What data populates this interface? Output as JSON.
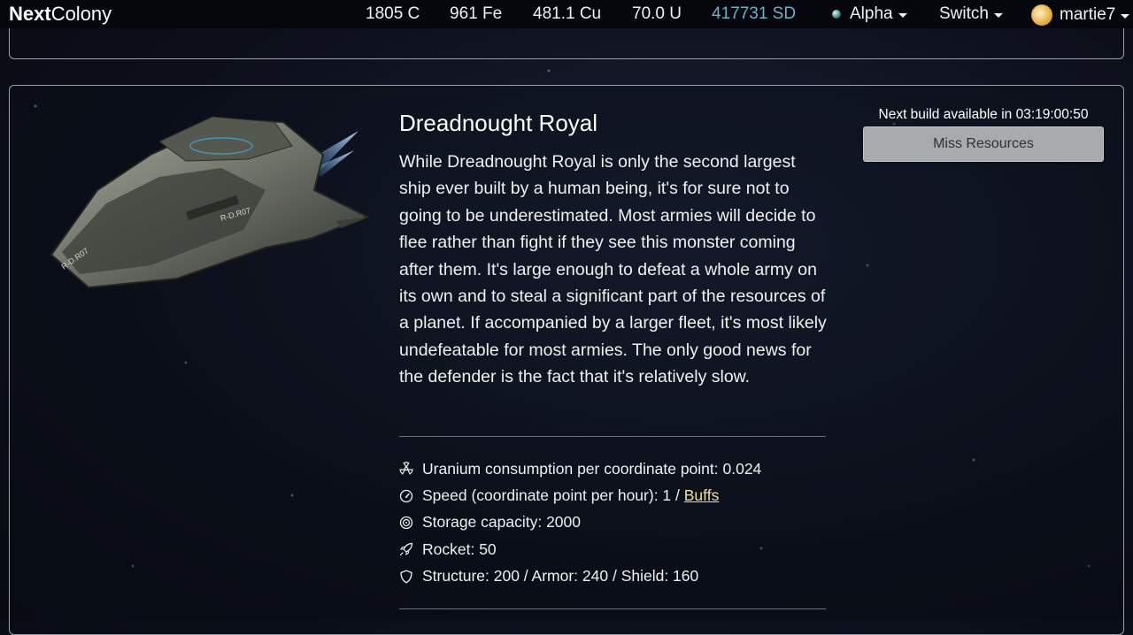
{
  "navbar": {
    "brand_bold": "Next",
    "brand_rest": "Colony",
    "resources": {
      "coal": "1805 C",
      "ore": "961 Fe",
      "copper": "481.1 Cu",
      "uranium": "70.0 U",
      "sd": "417731 SD"
    },
    "planet_label": "Alpha",
    "switch_label": "Switch",
    "user_label": "martie7"
  },
  "ship": {
    "hull_marking_1": "R-D.R07",
    "hull_marking_2": "R-D.R07",
    "name": "Dreadnought Royal",
    "description": "While Dreadnought Royal is only the second largest ship ever built by a human being, it's for sure not to going to be underestimated. Most armies will decide to flee rather than fight if they see this monster coming after them. It's large enough to defeat a whole army on its own and to steal a significant part of the resources of a planet. If accompanied by a larger fleet, it's most likely undefeatable for most armies. The only good news for the defender is the fact that it's relatively slow.",
    "stats": {
      "uranium": "Uranium consumption per coordinate point: 0.024",
      "speed_prefix": "Speed (coordinate point per hour): 1 / ",
      "speed_link": "Buffs",
      "storage": "Storage capacity: 2000",
      "rocket": "Rocket: 50",
      "defense": "Structure: 200 / Armor: 240 / Shield: 160"
    }
  },
  "build": {
    "next_build_text": "Next build available in 03:19:00:50",
    "button_label": "Miss Resources"
  },
  "icons": {
    "radiation": "radiation-icon",
    "speed": "speedometer-icon",
    "storage": "storage-icon",
    "rocket": "rocket-icon",
    "shield": "shield-icon"
  },
  "colors": {
    "sd_accent": "#6fb0c8",
    "link_accent": "#f1dfa0",
    "button_bg": "#a9aaae"
  }
}
